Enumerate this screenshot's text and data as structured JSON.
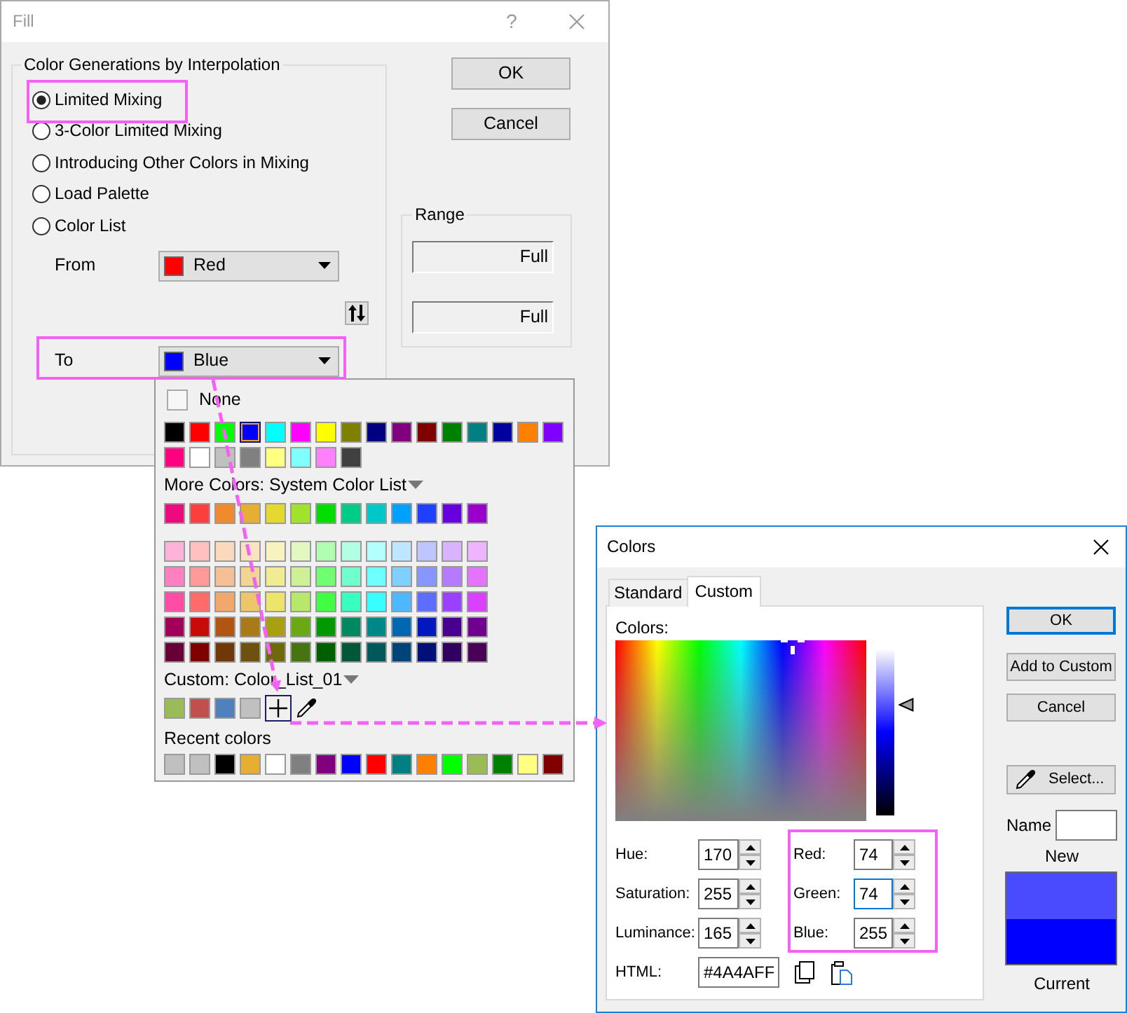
{
  "fill_dialog": {
    "title": "Fill",
    "help_button": "?",
    "interpolation_group": {
      "title": "Color Generations by Interpolation",
      "options": [
        {
          "label": "Limited Mixing",
          "selected": true
        },
        {
          "label": "3-Color Limited Mixing",
          "selected": false
        },
        {
          "label": "Introducing Other Colors in Mixing",
          "selected": false
        },
        {
          "label": "Load Palette",
          "selected": false
        },
        {
          "label": "Color List",
          "selected": false
        }
      ],
      "from": {
        "label": "From",
        "value": "Red",
        "color": "#ff0000"
      },
      "to": {
        "label": "To",
        "value": "Blue",
        "color": "#0000ff"
      }
    },
    "buttons": [
      "OK",
      "Cancel"
    ],
    "range_group": {
      "title": "Range",
      "fields": [
        "Full",
        "Full"
      ]
    }
  },
  "color_popup": {
    "none": {
      "label": "None",
      "checked": false
    },
    "basic_colors": [
      {
        "color": "#000000",
        "selected": false
      },
      {
        "color": "#ff0000",
        "selected": false
      },
      {
        "color": "#00ff00",
        "selected": false
      },
      {
        "color": "#0000ff",
        "selected": true
      },
      {
        "color": "#00ffff",
        "selected": false
      },
      {
        "color": "#ff00ff",
        "selected": false
      },
      {
        "color": "#ffff00",
        "selected": false
      },
      {
        "color": "#808000",
        "selected": false
      },
      {
        "color": "#000080",
        "selected": false
      },
      {
        "color": "#800080",
        "selected": false
      },
      {
        "color": "#800000",
        "selected": false
      },
      {
        "color": "#008000",
        "selected": false
      },
      {
        "color": "#008080",
        "selected": false
      },
      {
        "color": "#0000a0",
        "selected": false
      },
      {
        "color": "#ff8000",
        "selected": false
      },
      {
        "color": "#8000ff",
        "selected": false
      },
      {
        "color": "#ff0080",
        "selected": false
      },
      {
        "color": "#ffffff",
        "selected": false
      },
      {
        "color": "#c0c0c0",
        "selected": false
      },
      {
        "color": "#808080",
        "selected": false
      },
      {
        "color": "#ffff80",
        "selected": false
      },
      {
        "color": "#80ffff",
        "selected": false
      },
      {
        "color": "#ff80ff",
        "selected": false
      },
      {
        "color": "#404040",
        "selected": false
      }
    ],
    "more_colors_label": "More Colors: System Color List",
    "system_colors": [
      {
        "color": "#ed0a7f",
        "selected": false
      },
      {
        "color": "#fb3f3f",
        "selected": false
      },
      {
        "color": "#f18a2d",
        "selected": false
      },
      {
        "color": "#e6ae32",
        "selected": false
      },
      {
        "color": "#e5d82e",
        "selected": false
      },
      {
        "color": "#a1e22e",
        "selected": false
      },
      {
        "color": "#00dd00",
        "selected": false
      },
      {
        "color": "#00cc88",
        "selected": false
      },
      {
        "color": "#00c8c8",
        "selected": false
      },
      {
        "color": "#00a0ff",
        "selected": false
      },
      {
        "color": "#2040ff",
        "selected": false
      },
      {
        "color": "#6600dd",
        "selected": false
      },
      {
        "color": "#9900cc",
        "selected": false
      }
    ],
    "shade_colors": [
      {
        "color": "#ffb3d9",
        "selected": false
      },
      {
        "color": "#ffc0c0",
        "selected": false
      },
      {
        "color": "#fad9bd",
        "selected": false
      },
      {
        "color": "#fbe3c0",
        "selected": false
      },
      {
        "color": "#f7f3c0",
        "selected": false
      },
      {
        "color": "#e3f7c0",
        "selected": false
      },
      {
        "color": "#b0ffb0",
        "selected": false
      },
      {
        "color": "#b3ffe6",
        "selected": false
      },
      {
        "color": "#b3ffff",
        "selected": false
      },
      {
        "color": "#bfe6ff",
        "selected": false
      },
      {
        "color": "#bfc6ff",
        "selected": false
      },
      {
        "color": "#d9b3ff",
        "selected": false
      },
      {
        "color": "#f0b3ff",
        "selected": false
      },
      {
        "color": "#ff80c0",
        "selected": false
      },
      {
        "color": "#ff9a9a",
        "selected": false
      },
      {
        "color": "#f5c095",
        "selected": false
      },
      {
        "color": "#f2d594",
        "selected": false
      },
      {
        "color": "#f0ec94",
        "selected": false
      },
      {
        "color": "#d0f098",
        "selected": false
      },
      {
        "color": "#70ff70",
        "selected": false
      },
      {
        "color": "#70ffcc",
        "selected": false
      },
      {
        "color": "#70ffff",
        "selected": false
      },
      {
        "color": "#80d0ff",
        "selected": false
      },
      {
        "color": "#8896ff",
        "selected": false
      },
      {
        "color": "#b67aff",
        "selected": false
      },
      {
        "color": "#e573ff",
        "selected": false
      },
      {
        "color": "#ff4da6",
        "selected": false
      },
      {
        "color": "#ff6a6a",
        "selected": false
      },
      {
        "color": "#f2a86a",
        "selected": false
      },
      {
        "color": "#edc56a",
        "selected": false
      },
      {
        "color": "#ede46a",
        "selected": false
      },
      {
        "color": "#b8e86a",
        "selected": false
      },
      {
        "color": "#40ff40",
        "selected": false
      },
      {
        "color": "#38ffc0",
        "selected": false
      },
      {
        "color": "#38ffff",
        "selected": false
      },
      {
        "color": "#4db8ff",
        "selected": false
      },
      {
        "color": "#5c6eff",
        "selected": false
      },
      {
        "color": "#9a40ff",
        "selected": false
      },
      {
        "color": "#d940ff",
        "selected": false
      },
      {
        "color": "#a0005a",
        "selected": false
      },
      {
        "color": "#c80a0a",
        "selected": false
      },
      {
        "color": "#b05512",
        "selected": false
      },
      {
        "color": "#a87a18",
        "selected": false
      },
      {
        "color": "#a8a010",
        "selected": false
      },
      {
        "color": "#6aa814",
        "selected": false
      },
      {
        "color": "#009a00",
        "selected": false
      },
      {
        "color": "#008860",
        "selected": false
      },
      {
        "color": "#008888",
        "selected": false
      },
      {
        "color": "#0068b0",
        "selected": false
      },
      {
        "color": "#0018c0",
        "selected": false
      },
      {
        "color": "#480090",
        "selected": false
      },
      {
        "color": "#700090",
        "selected": false
      },
      {
        "color": "#680038",
        "selected": false
      },
      {
        "color": "#800000",
        "selected": false
      },
      {
        "color": "#703808",
        "selected": false
      },
      {
        "color": "#6e5010",
        "selected": false
      },
      {
        "color": "#6e6a0a",
        "selected": false
      },
      {
        "color": "#467410",
        "selected": false
      },
      {
        "color": "#006000",
        "selected": false
      },
      {
        "color": "#005838",
        "selected": false
      },
      {
        "color": "#005858",
        "selected": false
      },
      {
        "color": "#004478",
        "selected": false
      },
      {
        "color": "#001078",
        "selected": false
      },
      {
        "color": "#300060",
        "selected": false
      },
      {
        "color": "#480058",
        "selected": false
      }
    ],
    "custom_label": "Custom: Color_List_01",
    "custom_colors": [
      {
        "color": "#9bbb59",
        "selected": false
      },
      {
        "color": "#c0504d",
        "selected": false
      },
      {
        "color": "#4f81bd",
        "selected": false
      },
      {
        "color": "#c0c0c0",
        "selected": false
      }
    ],
    "recent_label": "Recent colors",
    "recent_colors": [
      {
        "color": "#c0c0c0",
        "selected": false
      },
      {
        "color": "#c0c0c0",
        "selected": false
      },
      {
        "color": "#000000",
        "selected": false
      },
      {
        "color": "#e6ae32",
        "selected": false
      },
      {
        "color": "#ffffff",
        "selected": false
      },
      {
        "color": "#808080",
        "selected": false
      },
      {
        "color": "#800080",
        "selected": false
      },
      {
        "color": "#0000ff",
        "selected": false
      },
      {
        "color": "#ff0000",
        "selected": false
      },
      {
        "color": "#008080",
        "selected": false
      },
      {
        "color": "#ff8000",
        "selected": false
      },
      {
        "color": "#00ff00",
        "selected": false
      },
      {
        "color": "#9bbb59",
        "selected": false
      },
      {
        "color": "#008000",
        "selected": false
      },
      {
        "color": "#ffff80",
        "selected": false
      },
      {
        "color": "#800000",
        "selected": false
      }
    ]
  },
  "colors_dialog": {
    "title": "Colors",
    "tabs": [
      {
        "label": "Standard",
        "selected": false
      },
      {
        "label": "Custom",
        "selected": true
      }
    ],
    "custom_tab": {
      "colors_label": "Colors:",
      "luminance_slider": {
        "level": 0.66
      },
      "hsl_fields": [
        {
          "label": "Hue:",
          "value": "170",
          "focused": false
        },
        {
          "label": "Saturation:",
          "value": "255",
          "focused": false
        },
        {
          "label": "Luminance:",
          "value": "165",
          "focused": false
        }
      ],
      "rgb_fields": [
        {
          "label": "Red:",
          "value": "74",
          "focused": false
        },
        {
          "label": "Green:",
          "value": "74",
          "focused": true
        },
        {
          "label": "Blue:",
          "value": "255",
          "focused": false
        }
      ],
      "html": {
        "label": "HTML:",
        "value": "#4A4AFF"
      }
    },
    "buttons": [
      {
        "label": "OK",
        "default": true
      },
      {
        "label": "Add to Custom",
        "default": false
      },
      {
        "label": "Cancel",
        "default": false
      }
    ],
    "select_button": "Select...",
    "name_field": {
      "label": "Name"
    },
    "preview": [
      {
        "label": "New",
        "color": "#4a4aff"
      },
      {
        "label": "Current",
        "color": "#0000ff"
      }
    ]
  }
}
